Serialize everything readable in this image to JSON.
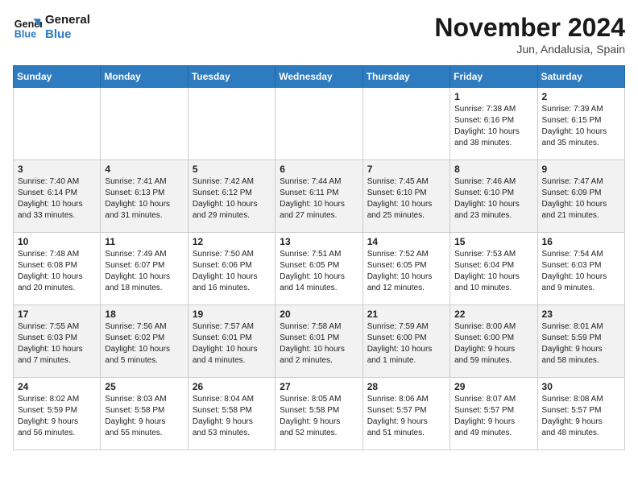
{
  "logo": {
    "line1": "General",
    "line2": "Blue"
  },
  "title": "November 2024",
  "subtitle": "Jun, Andalusia, Spain",
  "weekdays": [
    "Sunday",
    "Monday",
    "Tuesday",
    "Wednesday",
    "Thursday",
    "Friday",
    "Saturday"
  ],
  "weeks": [
    [
      {
        "day": "",
        "info": ""
      },
      {
        "day": "",
        "info": ""
      },
      {
        "day": "",
        "info": ""
      },
      {
        "day": "",
        "info": ""
      },
      {
        "day": "",
        "info": ""
      },
      {
        "day": "1",
        "info": "Sunrise: 7:38 AM\nSunset: 6:16 PM\nDaylight: 10 hours\nand 38 minutes."
      },
      {
        "day": "2",
        "info": "Sunrise: 7:39 AM\nSunset: 6:15 PM\nDaylight: 10 hours\nand 35 minutes."
      }
    ],
    [
      {
        "day": "3",
        "info": "Sunrise: 7:40 AM\nSunset: 6:14 PM\nDaylight: 10 hours\nand 33 minutes."
      },
      {
        "day": "4",
        "info": "Sunrise: 7:41 AM\nSunset: 6:13 PM\nDaylight: 10 hours\nand 31 minutes."
      },
      {
        "day": "5",
        "info": "Sunrise: 7:42 AM\nSunset: 6:12 PM\nDaylight: 10 hours\nand 29 minutes."
      },
      {
        "day": "6",
        "info": "Sunrise: 7:44 AM\nSunset: 6:11 PM\nDaylight: 10 hours\nand 27 minutes."
      },
      {
        "day": "7",
        "info": "Sunrise: 7:45 AM\nSunset: 6:10 PM\nDaylight: 10 hours\nand 25 minutes."
      },
      {
        "day": "8",
        "info": "Sunrise: 7:46 AM\nSunset: 6:10 PM\nDaylight: 10 hours\nand 23 minutes."
      },
      {
        "day": "9",
        "info": "Sunrise: 7:47 AM\nSunset: 6:09 PM\nDaylight: 10 hours\nand 21 minutes."
      }
    ],
    [
      {
        "day": "10",
        "info": "Sunrise: 7:48 AM\nSunset: 6:08 PM\nDaylight: 10 hours\nand 20 minutes."
      },
      {
        "day": "11",
        "info": "Sunrise: 7:49 AM\nSunset: 6:07 PM\nDaylight: 10 hours\nand 18 minutes."
      },
      {
        "day": "12",
        "info": "Sunrise: 7:50 AM\nSunset: 6:06 PM\nDaylight: 10 hours\nand 16 minutes."
      },
      {
        "day": "13",
        "info": "Sunrise: 7:51 AM\nSunset: 6:05 PM\nDaylight: 10 hours\nand 14 minutes."
      },
      {
        "day": "14",
        "info": "Sunrise: 7:52 AM\nSunset: 6:05 PM\nDaylight: 10 hours\nand 12 minutes."
      },
      {
        "day": "15",
        "info": "Sunrise: 7:53 AM\nSunset: 6:04 PM\nDaylight: 10 hours\nand 10 minutes."
      },
      {
        "day": "16",
        "info": "Sunrise: 7:54 AM\nSunset: 6:03 PM\nDaylight: 10 hours\nand 9 minutes."
      }
    ],
    [
      {
        "day": "17",
        "info": "Sunrise: 7:55 AM\nSunset: 6:03 PM\nDaylight: 10 hours\nand 7 minutes."
      },
      {
        "day": "18",
        "info": "Sunrise: 7:56 AM\nSunset: 6:02 PM\nDaylight: 10 hours\nand 5 minutes."
      },
      {
        "day": "19",
        "info": "Sunrise: 7:57 AM\nSunset: 6:01 PM\nDaylight: 10 hours\nand 4 minutes."
      },
      {
        "day": "20",
        "info": "Sunrise: 7:58 AM\nSunset: 6:01 PM\nDaylight: 10 hours\nand 2 minutes."
      },
      {
        "day": "21",
        "info": "Sunrise: 7:59 AM\nSunset: 6:00 PM\nDaylight: 10 hours\nand 1 minute."
      },
      {
        "day": "22",
        "info": "Sunrise: 8:00 AM\nSunset: 6:00 PM\nDaylight: 9 hours\nand 59 minutes."
      },
      {
        "day": "23",
        "info": "Sunrise: 8:01 AM\nSunset: 5:59 PM\nDaylight: 9 hours\nand 58 minutes."
      }
    ],
    [
      {
        "day": "24",
        "info": "Sunrise: 8:02 AM\nSunset: 5:59 PM\nDaylight: 9 hours\nand 56 minutes."
      },
      {
        "day": "25",
        "info": "Sunrise: 8:03 AM\nSunset: 5:58 PM\nDaylight: 9 hours\nand 55 minutes."
      },
      {
        "day": "26",
        "info": "Sunrise: 8:04 AM\nSunset: 5:58 PM\nDaylight: 9 hours\nand 53 minutes."
      },
      {
        "day": "27",
        "info": "Sunrise: 8:05 AM\nSunset: 5:58 PM\nDaylight: 9 hours\nand 52 minutes."
      },
      {
        "day": "28",
        "info": "Sunrise: 8:06 AM\nSunset: 5:57 PM\nDaylight: 9 hours\nand 51 minutes."
      },
      {
        "day": "29",
        "info": "Sunrise: 8:07 AM\nSunset: 5:57 PM\nDaylight: 9 hours\nand 49 minutes."
      },
      {
        "day": "30",
        "info": "Sunrise: 8:08 AM\nSunset: 5:57 PM\nDaylight: 9 hours\nand 48 minutes."
      }
    ]
  ]
}
